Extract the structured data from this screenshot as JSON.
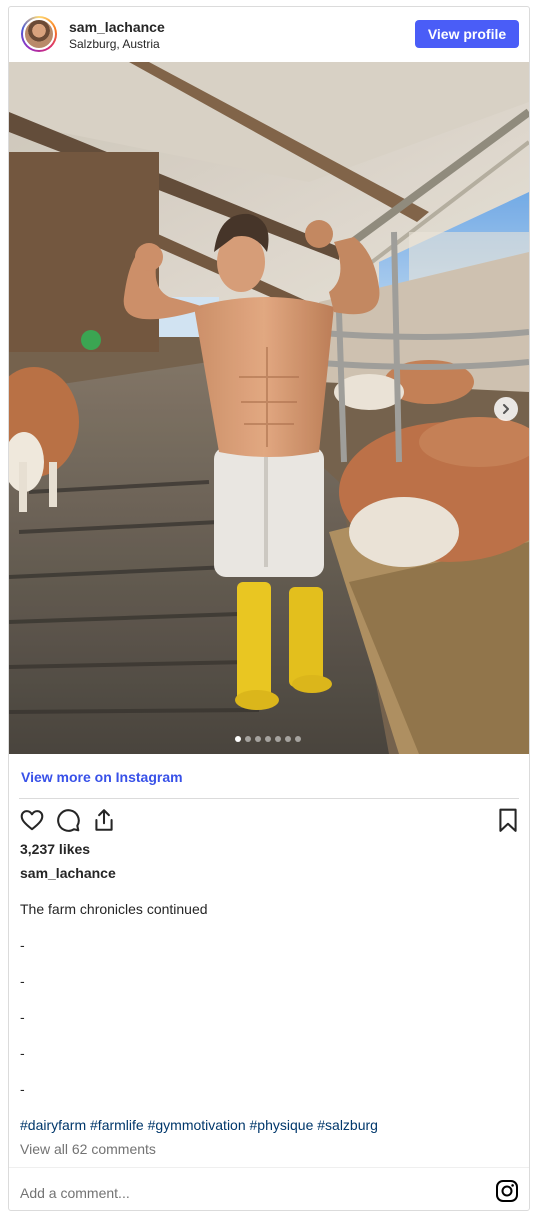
{
  "header": {
    "username": "sam_lachance",
    "location": "Salzburg, Austria",
    "view_profile_label": "View profile"
  },
  "media": {
    "carousel_count": 7,
    "active_index": 0
  },
  "view_more_label": "View more on Instagram",
  "likes": "3,237 likes",
  "caption": {
    "username": "sam_lachance",
    "lines": [
      "The farm chronicles continued",
      "-",
      "-",
      "-",
      "-",
      "-"
    ],
    "hashtags": "#dairyfarm #farmlife #gymmotivation #physique #salzburg"
  },
  "view_comments": "View all 62 comments",
  "comment_placeholder": "Add a comment...",
  "colors": {
    "accent": "#4a5df7",
    "link": "#3851e8",
    "hashtag": "#00376b",
    "boots": "#e8c417"
  },
  "icons": [
    "heart-icon",
    "comment-icon",
    "share-icon",
    "bookmark-icon",
    "chevron-right-icon",
    "instagram-icon"
  ]
}
